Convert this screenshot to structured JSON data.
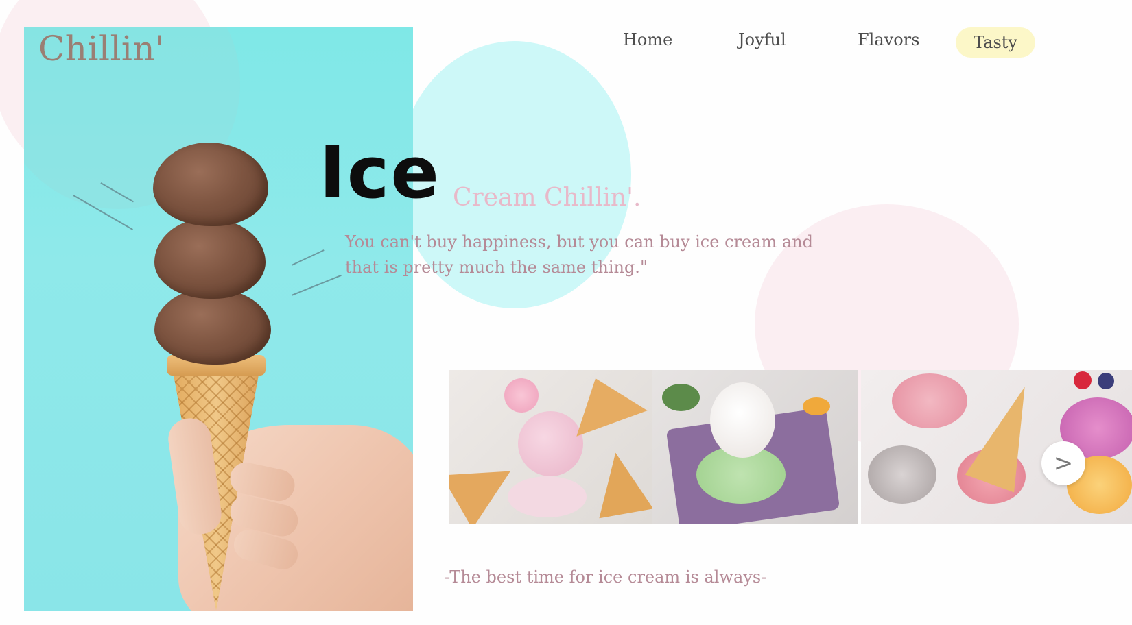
{
  "brand": {
    "logo": "Chillin'"
  },
  "nav": {
    "items": [
      {
        "label": "Home",
        "active": false
      },
      {
        "label": "Joyful",
        "active": false
      },
      {
        "label": "Flavors",
        "active": false
      },
      {
        "label": "Tasty",
        "active": true
      }
    ]
  },
  "hero": {
    "headline": "Ice",
    "subheadline": "Cream Chillin'.",
    "quote_line1": "You can't buy happiness, but you can buy ice cream and",
    "quote_line2": "that is pretty much the same thing.\""
  },
  "gallery": {
    "next_label": ">",
    "icon": "chevron-right-icon"
  },
  "footer": {
    "tagline": "-The best time for ice cream is always-"
  },
  "colors": {
    "hero_bg": "#8ae5e8",
    "accent_cyan": "#cdf8f8",
    "accent_pink": "#e8b9c9",
    "tasty_pill": "#fcf7c8",
    "logo": "#9a7f74"
  }
}
